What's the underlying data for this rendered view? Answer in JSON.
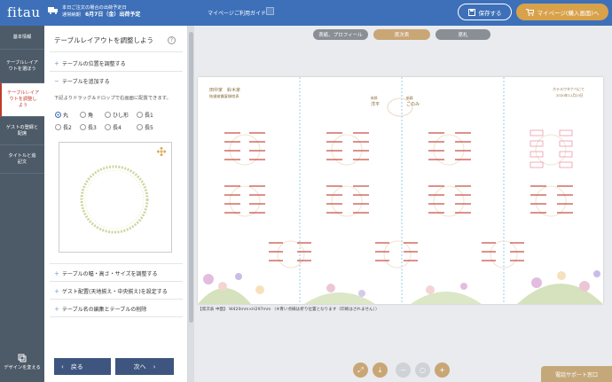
{
  "header": {
    "logo": "fitau",
    "delivery_line1": "本日ご注文の場合の出荷予定日",
    "delivery_label": "通常納期",
    "delivery_date": "6月7日（金）出荷予定",
    "nav_mypage": "マイページ",
    "nav_guide": "ご利用ガイド",
    "save_label": "保存する",
    "mypage_purchase_label": "マイページ(購入画面)へ",
    "brand_color": "#3d70b8",
    "accent_color": "#d8a24a"
  },
  "sidebar": {
    "items": [
      {
        "label": "基本情報"
      },
      {
        "label": "テーブルレイアウトを選ぼう"
      },
      {
        "label": "テーブルレイアウトを調整しよう"
      },
      {
        "label": "ゲストの登録と配席"
      },
      {
        "label": "タイトルと追記文"
      }
    ],
    "design_label": "デザインを変える"
  },
  "panel": {
    "title": "テーブルレイアウトを調整しよう",
    "help": "?",
    "acc_position": "テーブルの位置を調整する",
    "acc_add": "テーブルを追加する",
    "add_desc": "下記よりドラッグ＆ドロップで右画面に配置できます。",
    "shapes_row1": [
      "丸",
      "角",
      "ひし形",
      "長1"
    ],
    "shapes_row2": [
      "長2",
      "長3",
      "長4",
      "長5"
    ],
    "selected_shape": "丸",
    "acc_size": "テーブルの幅・高さ・サイズを調整する",
    "acc_align": "ゲスト配置(天地揃え・中央揃え)を設定する",
    "acc_name": "テーブル名の編集とテーブルの削除",
    "back_label": "戻る",
    "next_label": "次へ"
  },
  "tabs": [
    "表紙、プロフィール",
    "席次表",
    "席札"
  ],
  "active_tab": "席次表",
  "paper": {
    "families": "田中家　鈴木家",
    "subtitle": "結婚披露宴御席表",
    "groom_label": "新郎",
    "groom": "洋平",
    "bride_label": "新婦",
    "bride": "このみ",
    "hotel": "ホテルワタナベにて",
    "date": "2020年11月23日"
  },
  "note": "【席次表 中面】 W420mm×H297mm 〈※青い点線は折り位置となります（印刷はされません）〉",
  "support_label": "電話サポート窓口"
}
